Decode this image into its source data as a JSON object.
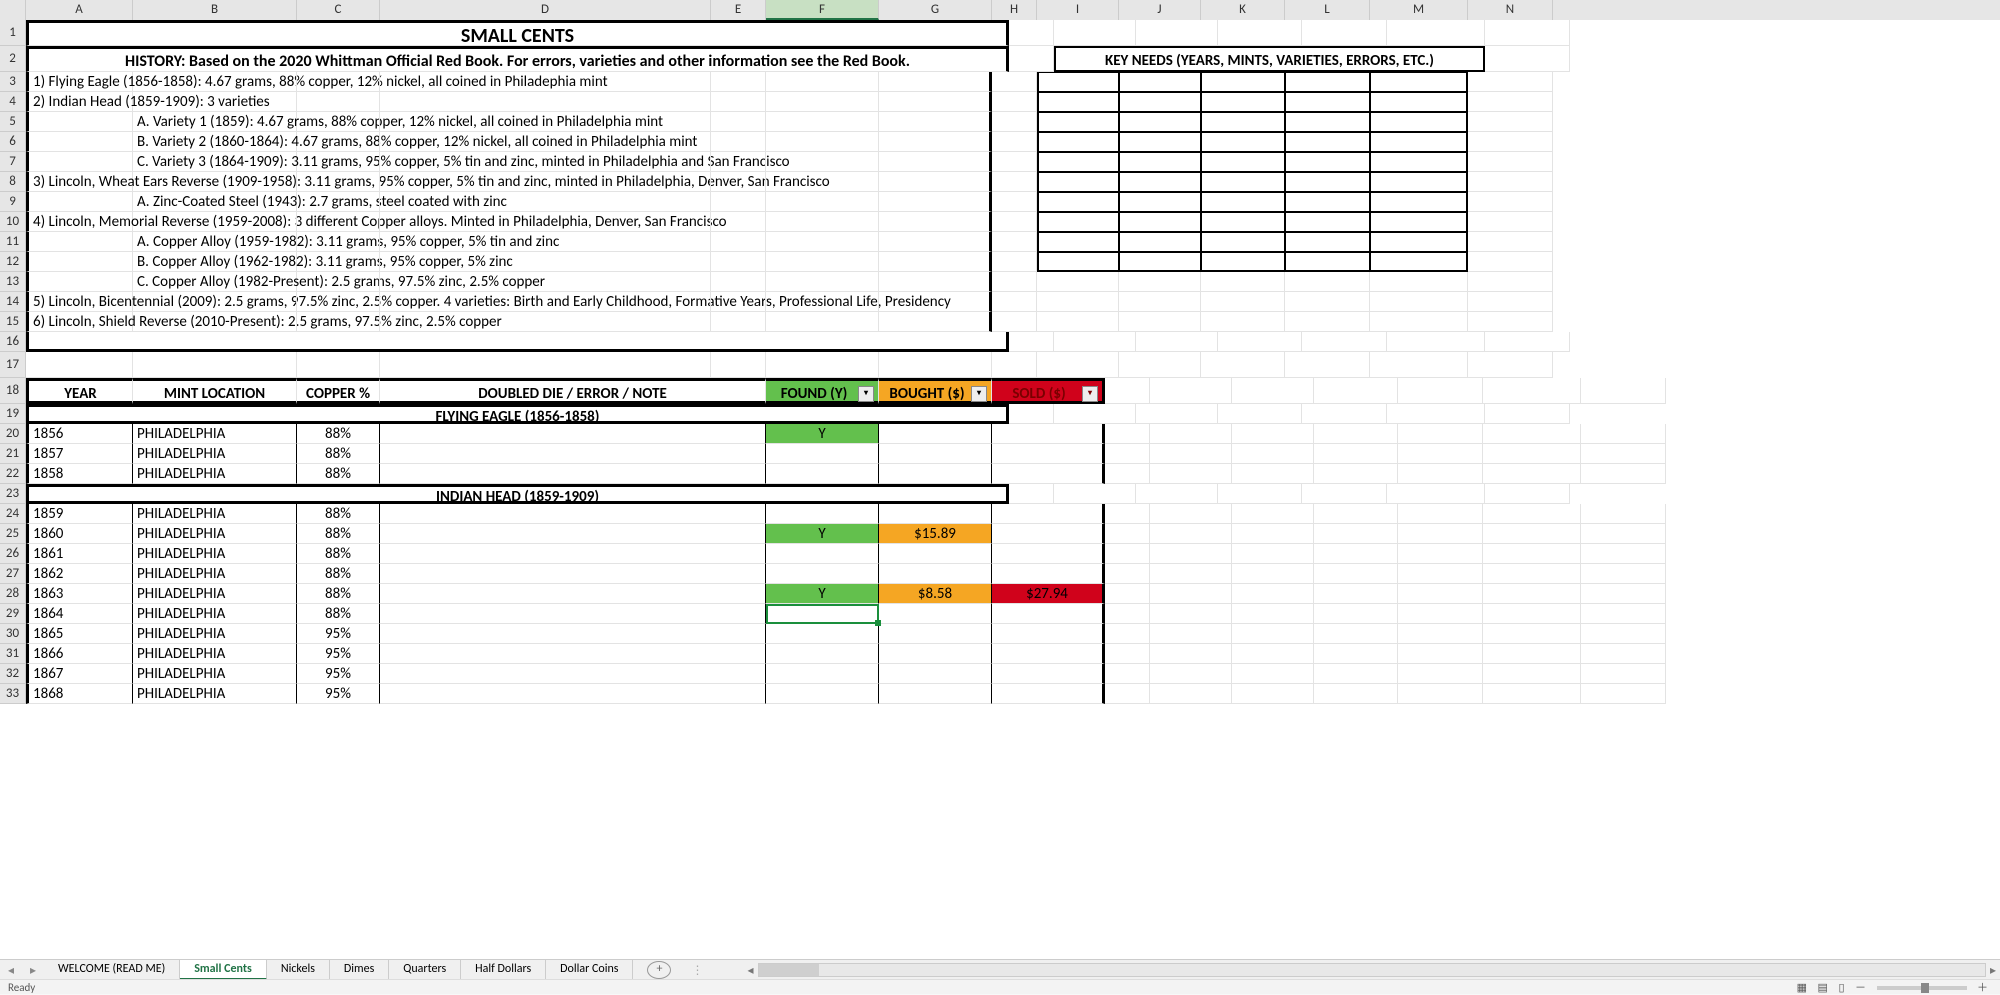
{
  "columns": [
    "A",
    "B",
    "C",
    "D",
    "E",
    "F",
    "G",
    "H",
    "I",
    "J",
    "K",
    "L",
    "M",
    "N"
  ],
  "active_column": "F",
  "title": "SMALL CENTS",
  "subtitle": "HISTORY: Based on the 2020 Whittman Official Red Book. For errors, varieties and other information see the Red Book.",
  "history_lines": [
    "1) Flying Eagle (1856-1858): 4.67 grams, 88% copper, 12% nickel, all coined in Philadephia mint",
    "2) Indian Head (1859-1909): 3 varieties",
    "        A. Variety 1 (1859): 4.67 grams, 88% copper, 12% nickel, all coined in Philadelphia mint",
    "        B. Variety 2 (1860-1864): 4.67 grams, 88% copper, 12% nickel, all coined in Philadelphia mint",
    "        C. Variety 3 (1864-1909): 3.11 grams, 95% copper, 5% tin and zinc, minted in Philadelphia and San Francisco",
    "3) Lincoln, Wheat Ears Reverse (1909-1958): 3.11 grams, 95% copper, 5% tin and zinc, minted in Philadelphia, Denver, San Francisco",
    "        A. Zinc-Coated Steel (1943): 2.7 grams, steel coated with zinc",
    "4) Lincoln, Memorial Reverse (1959-2008): 3 different Copper alloys. Minted in Philadelphia, Denver, San Francisco",
    "        A. Copper Alloy (1959-1982): 3.11 grams, 95% copper, 5% tin and zinc",
    "        B. Copper Alloy (1962-1982): 3.11 grams, 95% copper, 5% zinc",
    "        C. Copper Alloy (1982-Present): 2.5 grams, 97.5% zinc, 2.5% copper",
    "5) Lincoln, Bicentennial (2009): 2.5 grams, 97.5% zinc, 2.5% copper. 4 varieties: Birth and Early Childhood, Formative Years, Professional Life, Presidency",
    "6) Lincoln, Shield Reverse (2010-Present): 2.5 grams, 97.5% zinc, 2.5% copper"
  ],
  "key_needs_header": "KEY NEEDS (YEARS, MINTS, VARIETIES, ERRORS, ETC.)",
  "table_headers": {
    "year": "YEAR",
    "mint": "MINT LOCATION",
    "copper": "COPPER %",
    "note": "DOUBLED DIE / ERROR / NOTE",
    "found": "FOUND (Y)",
    "bought": "BOUGHT ($)",
    "sold": "SOLD ($)"
  },
  "sections": [
    {
      "title": "FLYING EAGLE (1856-1858)",
      "rows": [
        {
          "year": "1856",
          "mint": "PHILADELPHIA",
          "copper": "88%",
          "found": "Y",
          "bought": "",
          "sold": ""
        },
        {
          "year": "1857",
          "mint": "PHILADELPHIA",
          "copper": "88%",
          "found": "",
          "bought": "",
          "sold": ""
        },
        {
          "year": "1858",
          "mint": "PHILADELPHIA",
          "copper": "88%",
          "found": "",
          "bought": "",
          "sold": ""
        }
      ]
    },
    {
      "title": "INDIAN HEAD (1859-1909)",
      "rows": [
        {
          "year": "1859",
          "mint": "PHILADELPHIA",
          "copper": "88%",
          "found": "",
          "bought": "",
          "sold": ""
        },
        {
          "year": "1860",
          "mint": "PHILADELPHIA",
          "copper": "88%",
          "found": "Y",
          "bought": "$15.89",
          "sold": ""
        },
        {
          "year": "1861",
          "mint": "PHILADELPHIA",
          "copper": "88%",
          "found": "",
          "bought": "",
          "sold": ""
        },
        {
          "year": "1862",
          "mint": "PHILADELPHIA",
          "copper": "88%",
          "found": "",
          "bought": "",
          "sold": ""
        },
        {
          "year": "1863",
          "mint": "PHILADELPHIA",
          "copper": "88%",
          "found": "Y",
          "bought": "$8.58",
          "sold": "$27.94"
        },
        {
          "year": "1864",
          "mint": "PHILADELPHIA",
          "copper": "88%",
          "found": "",
          "bought": "",
          "sold": ""
        },
        {
          "year": "1865",
          "mint": "PHILADELPHIA",
          "copper": "95%",
          "found": "",
          "bought": "",
          "sold": ""
        },
        {
          "year": "1866",
          "mint": "PHILADELPHIA",
          "copper": "95%",
          "found": "",
          "bought": "",
          "sold": ""
        },
        {
          "year": "1867",
          "mint": "PHILADELPHIA",
          "copper": "95%",
          "found": "",
          "bought": "",
          "sold": ""
        },
        {
          "year": "1868",
          "mint": "PHILADELPHIA",
          "copper": "95%",
          "found": "",
          "bought": "",
          "sold": ""
        }
      ]
    }
  ],
  "selected_cell": {
    "row": 29,
    "col": "F"
  },
  "sheet_tabs": [
    "WELCOME (READ ME)",
    "Small Cents",
    "Nickels",
    "Dimes",
    "Quarters",
    "Half Dollars",
    "Dollar Coins"
  ],
  "active_tab": "Small Cents",
  "status_text": "Ready"
}
